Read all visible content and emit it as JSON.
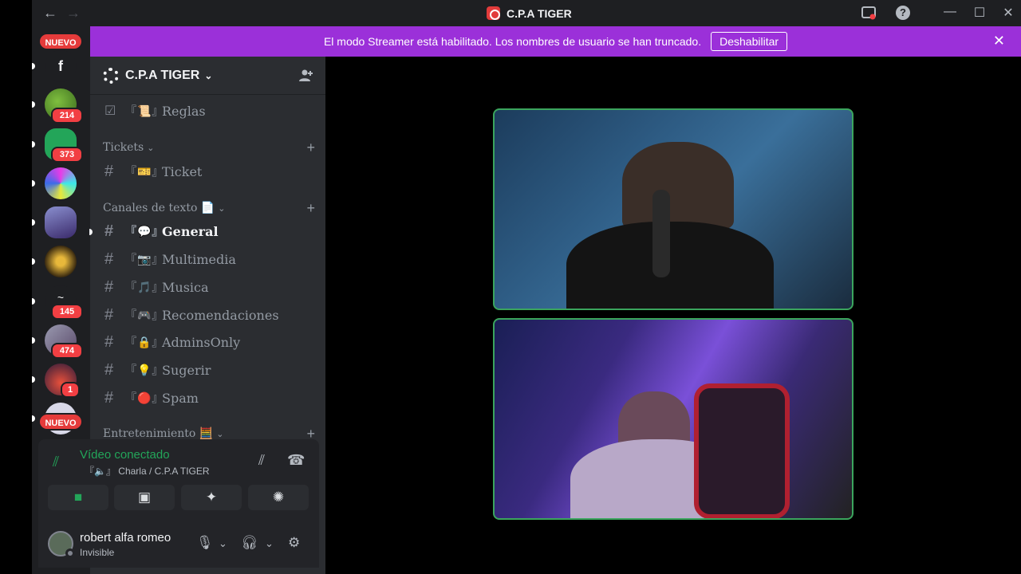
{
  "titlebar": {
    "back_icon": "←",
    "forward_icon": "→",
    "app_title": "C.P.A TIGER",
    "help_icon": "?",
    "minimize_icon": "—",
    "maximize_icon": "☐",
    "close_icon": "✕"
  },
  "banner": {
    "message": "El modo Streamer está habilitado. Los nombres de usuario se han truncado.",
    "button_label": "Deshabilitar",
    "close_icon": "✕"
  },
  "rail": {
    "nuevo_top": "NUEVO",
    "facebook_letter": "f",
    "badges": [
      "214",
      "373",
      "145",
      "474",
      "1"
    ],
    "nuevo_bottom": "NUEVO"
  },
  "server": {
    "name": "C.P.A TIGER",
    "chevron": "⌄"
  },
  "channels": {
    "rules": {
      "emoji": "『📜』",
      "label": "Reglas"
    },
    "tickets_category": "Tickets",
    "ticket": {
      "emoji": "『🎫』",
      "label": "Ticket"
    },
    "text_category": "Canales de texto 📄",
    "items": [
      {
        "emoji": "『💬』",
        "label": "General"
      },
      {
        "emoji": "『📷』",
        "label": "Multimedia"
      },
      {
        "emoji": "『🎵』",
        "label": "Musica"
      },
      {
        "emoji": "『🎮』",
        "label": "Recomendaciones"
      },
      {
        "emoji": "『🔒』",
        "label": "AdminsOnly"
      },
      {
        "emoji": "『💡』",
        "label": "Sugerir"
      },
      {
        "emoji": "『🔴』",
        "label": "Spam"
      }
    ],
    "entertainment_category": "Entretenimiento 🧮"
  },
  "voice": {
    "status": "Vídeo conectado",
    "location": "『🔈』 Charla / C.P.A TIGER"
  },
  "user": {
    "name": "robert alfa romeo",
    "status": "Invisible"
  }
}
